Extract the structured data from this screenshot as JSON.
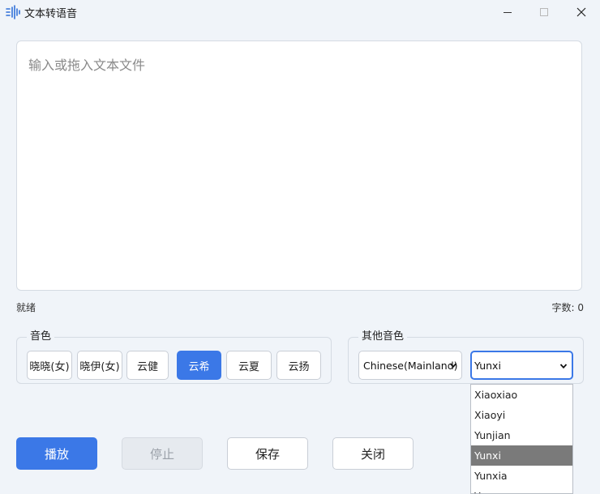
{
  "window": {
    "title": "文本转语音",
    "icon": "audio-wave-icon",
    "controls": [
      "minimize-icon",
      "maximize-icon",
      "close-icon"
    ]
  },
  "editor": {
    "placeholder": "输入或拖入文本文件",
    "value": ""
  },
  "status": {
    "state": "就绪",
    "char_count": "字数: 0"
  },
  "voice_group": {
    "legend": "音色",
    "buttons": [
      "晓晓(女)",
      "晓伊(女)",
      "云健",
      "云希",
      "云夏",
      "云扬"
    ],
    "active": "云希"
  },
  "other_group": {
    "legend": "其他音色",
    "language_value": "Chinese(Mainland)",
    "voice_value": "Yunxi",
    "options": [
      "Xiaoxiao",
      "Xiaoyi",
      "Yunjian",
      "Yunxi",
      "Yunxia",
      "Yunyang"
    ]
  },
  "actions": {
    "play": "播放",
    "stop": "停止",
    "save": "保存",
    "close": "关闭"
  },
  "colors": {
    "accent": "#3b78e7",
    "background": "#f0f4f9",
    "selected_option": "#7a7a7a"
  }
}
